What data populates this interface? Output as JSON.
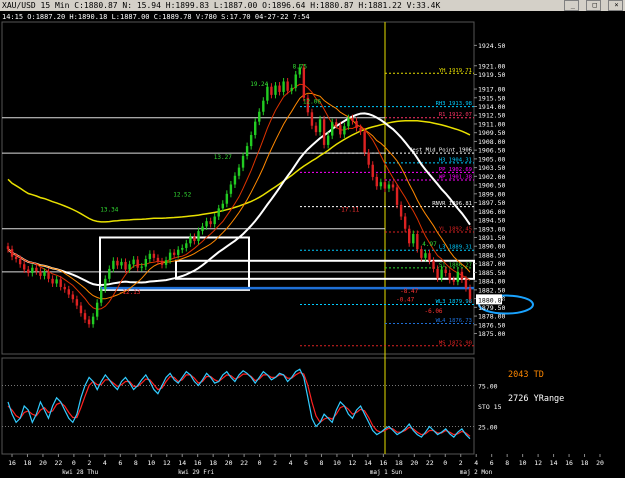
{
  "window": {
    "title": "XAU/USD 15 Min  C:1880.87  N:  15.94  H:1899.83  L:1887.00  O:1896.64  H:1880.87  H:1881.22  V:33.4K",
    "subtitle": "14:15  O:1887.20  H:1890.18  L:1887.00  C:1889.78  V:780  S:17.70  04-27-22  7:54",
    "buttons": [
      "_",
      "□",
      "×"
    ]
  },
  "colors": {
    "background": "#000000",
    "candle_up": "#22cc22",
    "candle_down": "#dd2222",
    "ma_yellow": "#e8e000",
    "ma_white": "#ffffff",
    "ma_orange": "#ff8800",
    "ma_red": "#dd3300",
    "ma_blue": "#1e6fd6",
    "stoch_fast": "#33ccff",
    "stoch_slow": "#ff2222",
    "highlight_circle": "#1aa3ff"
  },
  "chart_data": {
    "type": "line",
    "ylim": [
      1872,
      1928
    ],
    "y_tick_labels": [
      "1924.50",
      "1921.00",
      "1919.50",
      "1917.00",
      "1915.50",
      "1914.00",
      "1912.50",
      "1911.00",
      "1909.50",
      "1908.00",
      "1906.50",
      "1905.00",
      "1903.50",
      "1902.00",
      "1900.50",
      "1899.00",
      "1897.50",
      "1896.00",
      "1894.50",
      "1893.00",
      "1891.50",
      "1890.00",
      "1888.50",
      "1887.00",
      "1885.50",
      "1884.00",
      "1882.50",
      "1881.00",
      "1879.50",
      "1878.00",
      "1876.50",
      "1875.00"
    ],
    "current_price": 1880.87,
    "x_tick_labels": [
      "16",
      "18",
      "20",
      "22",
      "0",
      "2",
      "4",
      "6",
      "8",
      "10",
      "12",
      "14",
      "16",
      "18",
      "20",
      "22",
      "0",
      "2",
      "4",
      "6",
      "8",
      "10",
      "12",
      "14",
      "16",
      "18",
      "20",
      "22",
      "0",
      "2",
      "4",
      "6",
      "8",
      "10",
      "12",
      "14",
      "16",
      "18",
      "20"
    ],
    "day_labels": [
      "kwi 28 Thu",
      "kwi 29 Fri",
      "maj 1 Sun",
      "maj 2 Mon"
    ],
    "candles_close": [
      1889.5,
      1888.2,
      1887.8,
      1886.9,
      1886.0,
      1885.4,
      1886.3,
      1885.7,
      1884.9,
      1885.6,
      1884.4,
      1883.6,
      1884.3,
      1883.0,
      1882.6,
      1881.7,
      1880.9,
      1879.8,
      1878.5,
      1877.4,
      1876.6,
      1877.9,
      1880.3,
      1882.6,
      1884.4,
      1886.1,
      1887.5,
      1886.7,
      1887.3,
      1886.0,
      1886.9,
      1887.7,
      1886.3,
      1886.5,
      1887.8,
      1888.7,
      1888.0,
      1887.4,
      1886.8,
      1887.6,
      1888.9,
      1888.5,
      1889.4,
      1889.7,
      1890.5,
      1891.6,
      1890.9,
      1892.6,
      1893.4,
      1894.3,
      1893.8,
      1895.1,
      1896.5,
      1897.3,
      1899.0,
      1900.6,
      1902.1,
      1903.5,
      1905.5,
      1907.2,
      1909.1,
      1911.4,
      1913.1,
      1915.0,
      1917.4,
      1916.0,
      1917.6,
      1916.5,
      1918.3,
      1916.7,
      1917.2,
      1919.5,
      1920.7,
      1915.5,
      1913.0,
      1910.7,
      1909.6,
      1911.8,
      1907.4,
      1909.0,
      1911.3,
      1910.8,
      1909.2,
      1910.6,
      1912.0,
      1911.5,
      1910.3,
      1909.7,
      1906.1,
      1904.0,
      1901.9,
      1900.3,
      1901.0,
      1899.9,
      1900.6,
      1900.1,
      1897.1,
      1895.1,
      1893.0,
      1890.5,
      1892.1,
      1889.5,
      1888.0,
      1888.8,
      1887.5,
      1886.1,
      1884.5,
      1886.0,
      1885.4,
      1884.2,
      1883.9,
      1885.6,
      1884.3,
      1882.8,
      1880.9
    ],
    "levels": [
      {
        "label": "YH  1919.71",
        "value": 1919.71,
        "color": "#e8e000"
      },
      {
        "label": "RH3  1913.98",
        "value": 1913.98,
        "color": "#00ccff"
      },
      {
        "label": "R1  1912.07",
        "value": 1912.07,
        "color": "#ff3366"
      },
      {
        "label": "Yest Mid Point 1906",
        "value": 1906.0,
        "color": "#ffffff"
      },
      {
        "label": "H3  1904.31",
        "value": 1904.31,
        "color": "#00ccff"
      },
      {
        "label": "PP  1902.69",
        "value": 1902.69,
        "color": "#ff00ff"
      },
      {
        "label": "WP  1901.38",
        "value": 1901.38,
        "color": "#ff00ff"
      },
      {
        "label": "RNVR  1896.81",
        "value": 1896.81,
        "color": "#ffffff"
      },
      {
        "label": "YL  1892.45",
        "value": 1892.45,
        "color": "#dd2222"
      },
      {
        "label": "L3  1889.31",
        "value": 1889.31,
        "color": "#00ccff"
      },
      {
        "label": "S1  1886.27",
        "value": 1886.27,
        "color": "#33dd33"
      },
      {
        "label": "WL3  1879.98",
        "value": 1879.98,
        "color": "#00ccff"
      },
      {
        "label": "WL4  1876.73",
        "value": 1876.73,
        "color": "#1e6fd6"
      },
      {
        "label": "MS  1872.90",
        "value": 1872.9,
        "color": "#dd2222"
      }
    ],
    "annotations": [
      {
        "text": "13.34",
        "x": 25,
        "y": 1896.0,
        "color": "#33dd33"
      },
      {
        "text": "12.52",
        "x": 43,
        "y": 1898.5,
        "color": "#33dd33"
      },
      {
        "text": "13.27",
        "x": 53,
        "y": 1905.0,
        "color": "#33dd33"
      },
      {
        "text": "19.24",
        "x": 62,
        "y": 1917.5,
        "color": "#33dd33"
      },
      {
        "text": "8.75",
        "x": 72,
        "y": 1920.5,
        "color": "#33dd33"
      },
      {
        "text": "12.06",
        "x": 75,
        "y": 1914.5,
        "color": "#33dd33"
      },
      {
        "text": "4.97",
        "x": 104,
        "y": 1890.0,
        "color": "#33dd33"
      },
      {
        "text": "-12.13",
        "x": 30,
        "y": 1881.8,
        "color": "#ff3333"
      },
      {
        "text": "-17.11",
        "x": 84,
        "y": 1896.0,
        "color": "#ff3333"
      },
      {
        "text": "-8.47",
        "x": 99,
        "y": 1882.0,
        "color": "#ff3333"
      },
      {
        "text": "-0.47",
        "x": 98,
        "y": 1880.5,
        "color": "#ff3333"
      },
      {
        "text": "-6.06",
        "x": 105,
        "y": 1878.5,
        "color": "#ff3333"
      }
    ],
    "stoch_fast": [
      55,
      40,
      30,
      35,
      50,
      45,
      30,
      40,
      55,
      45,
      35,
      50,
      60,
      55,
      45,
      35,
      30,
      40,
      60,
      75,
      85,
      80,
      70,
      80,
      88,
      82,
      75,
      70,
      80,
      85,
      78,
      70,
      75,
      82,
      88,
      80,
      70,
      65,
      75,
      85,
      90,
      82,
      78,
      85,
      92,
      88,
      80,
      75,
      82,
      90,
      85,
      78,
      80,
      88,
      92,
      85,
      80,
      88,
      93,
      90,
      85,
      78,
      85,
      92,
      88,
      82,
      85,
      90,
      88,
      80,
      85,
      92,
      95,
      85,
      60,
      35,
      25,
      30,
      40,
      35,
      30,
      45,
      55,
      50,
      40,
      35,
      45,
      50,
      40,
      30,
      20,
      15,
      18,
      22,
      25,
      20,
      15,
      18,
      22,
      28,
      20,
      15,
      12,
      18,
      25,
      20,
      15,
      18,
      22,
      16,
      12,
      18,
      22,
      15,
      10
    ],
    "stoch_slow": [
      50,
      45,
      38,
      35,
      42,
      44,
      40,
      38,
      45,
      48,
      42,
      44,
      52,
      54,
      50,
      42,
      36,
      36,
      48,
      62,
      75,
      80,
      76,
      76,
      82,
      82,
      78,
      74,
      76,
      80,
      80,
      74,
      74,
      78,
      83,
      82,
      76,
      70,
      72,
      80,
      86,
      85,
      80,
      82,
      88,
      88,
      84,
      78,
      80,
      86,
      86,
      82,
      80,
      84,
      88,
      87,
      83,
      85,
      89,
      89,
      86,
      81,
      83,
      88,
      88,
      85,
      85,
      88,
      88,
      84,
      84,
      88,
      91,
      89,
      75,
      55,
      38,
      30,
      34,
      36,
      34,
      40,
      48,
      50,
      46,
      40,
      42,
      46,
      44,
      36,
      26,
      20,
      18,
      20,
      23,
      22,
      18,
      18,
      20,
      24,
      22,
      18,
      15,
      16,
      20,
      20,
      17,
      17,
      20,
      18,
      15,
      16,
      19,
      17,
      13
    ],
    "stoch_ylim": [
      -5,
      105
    ],
    "stoch_tick_labels": [
      "25.00",
      "75.00"
    ],
    "stoch_label": "STO  15",
    "info_labels": [
      "2043 TD",
      "2726 YRange"
    ]
  }
}
